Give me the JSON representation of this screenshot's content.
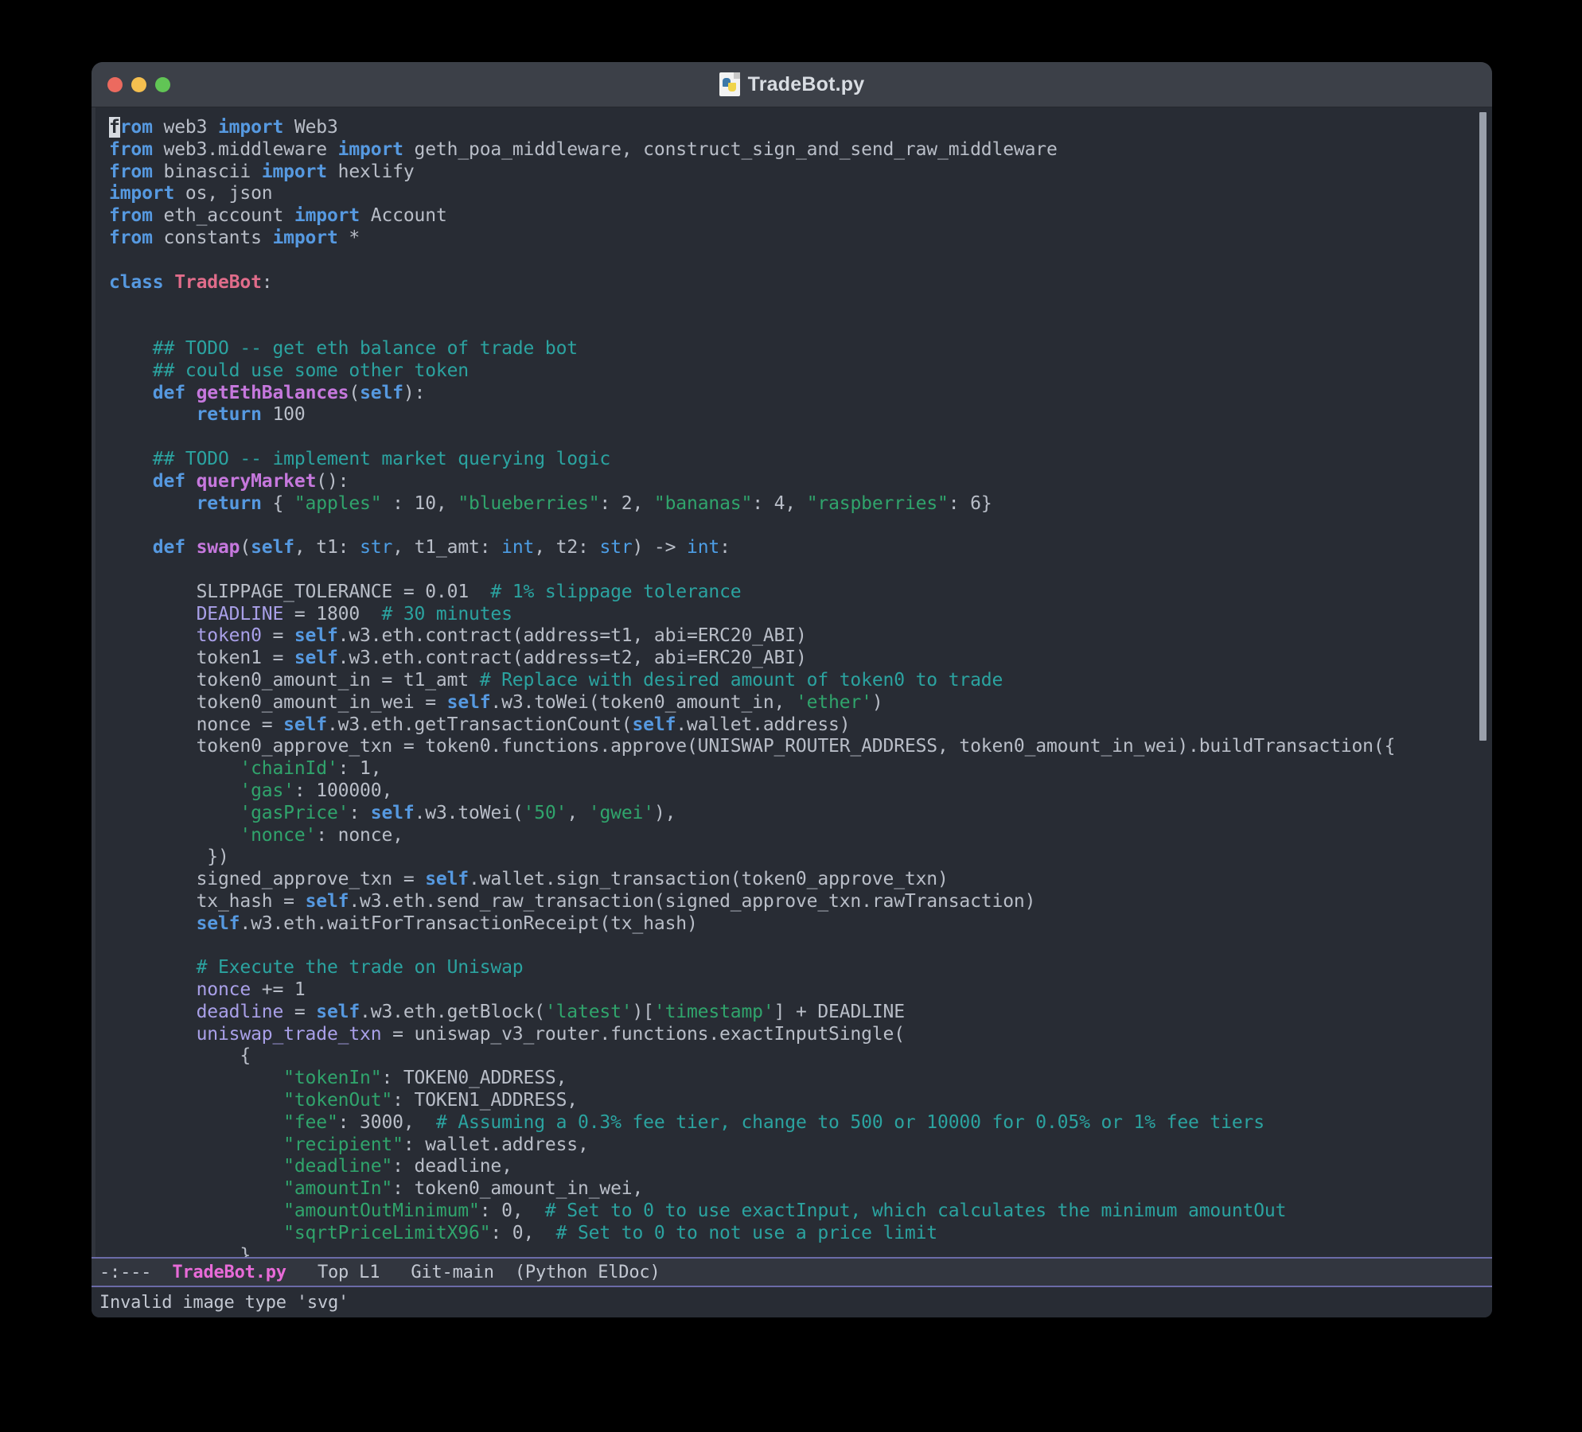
{
  "window": {
    "title": "TradeBot.py",
    "icon": "python-file-icon",
    "traffic_lights": [
      {
        "name": "close-button",
        "color": "#ec6a5f"
      },
      {
        "name": "minimize-button",
        "color": "#f5bf4f"
      },
      {
        "name": "maximize-button",
        "color": "#61c555"
      }
    ]
  },
  "theme": {
    "background": "#282c34",
    "titlebar": "#3c4048",
    "foreground": "#b9bec8",
    "keyword": "#5699e0",
    "class_name": "#e06c8a",
    "function_name": "#c678dd",
    "comment": "#2ba3a0",
    "string": "#30a46c",
    "variable": "#a9a0e8",
    "modeline_accent": "#6b6ba8",
    "modeline_filename": "#e86bd8"
  },
  "modeline": {
    "indicators": "-:---",
    "filename": "TradeBot.py",
    "position": "Top L1",
    "vc": "Git-main",
    "modes": "(Python ElDoc)"
  },
  "echo_area": {
    "message": "Invalid image type 'svg'"
  },
  "editor": {
    "cursor_line": 1,
    "cursor_column": 1,
    "language": "Python",
    "lines": [
      [
        {
          "t": "from",
          "c": "kw",
          "cursor_first": true
        },
        {
          "t": " web3 ",
          "c": "plain"
        },
        {
          "t": "import",
          "c": "kw"
        },
        {
          "t": " Web3",
          "c": "plain"
        }
      ],
      [
        {
          "t": "from",
          "c": "kw"
        },
        {
          "t": " web3.middleware ",
          "c": "plain"
        },
        {
          "t": "import",
          "c": "kw"
        },
        {
          "t": " geth_poa_middleware, construct_sign_and_send_raw_middleware",
          "c": "plain"
        }
      ],
      [
        {
          "t": "from",
          "c": "kw"
        },
        {
          "t": " binascii ",
          "c": "plain"
        },
        {
          "t": "import",
          "c": "kw"
        },
        {
          "t": " hexlify",
          "c": "plain"
        }
      ],
      [
        {
          "t": "import",
          "c": "kw"
        },
        {
          "t": " os, json",
          "c": "plain"
        }
      ],
      [
        {
          "t": "from",
          "c": "kw"
        },
        {
          "t": " eth_account ",
          "c": "plain"
        },
        {
          "t": "import",
          "c": "kw"
        },
        {
          "t": " Account",
          "c": "plain"
        }
      ],
      [
        {
          "t": "from",
          "c": "kw"
        },
        {
          "t": " constants ",
          "c": "plain"
        },
        {
          "t": "import",
          "c": "kw"
        },
        {
          "t": " *",
          "c": "plain"
        }
      ],
      [],
      [
        {
          "t": "class",
          "c": "kw"
        },
        {
          "t": " ",
          "c": "plain"
        },
        {
          "t": "TradeBot",
          "c": "cls"
        },
        {
          "t": ":",
          "c": "plain"
        }
      ],
      [],
      [],
      [
        {
          "t": "    ## TODO -- get eth balance of trade bot",
          "c": "cmt"
        }
      ],
      [
        {
          "t": "    ## could use some other token",
          "c": "cmt"
        }
      ],
      [
        {
          "t": "    ",
          "c": "plain"
        },
        {
          "t": "def",
          "c": "kw"
        },
        {
          "t": " ",
          "c": "plain"
        },
        {
          "t": "getEthBalances",
          "c": "fn"
        },
        {
          "t": "(",
          "c": "plain"
        },
        {
          "t": "self",
          "c": "self"
        },
        {
          "t": "):",
          "c": "plain"
        }
      ],
      [
        {
          "t": "        ",
          "c": "plain"
        },
        {
          "t": "return",
          "c": "kw"
        },
        {
          "t": " 100",
          "c": "plain"
        }
      ],
      [],
      [
        {
          "t": "    ## TODO -- implement market querying logic",
          "c": "cmt"
        }
      ],
      [
        {
          "t": "    ",
          "c": "plain"
        },
        {
          "t": "def",
          "c": "kw"
        },
        {
          "t": " ",
          "c": "plain"
        },
        {
          "t": "queryMarket",
          "c": "fn"
        },
        {
          "t": "():",
          "c": "plain"
        }
      ],
      [
        {
          "t": "        ",
          "c": "plain"
        },
        {
          "t": "return",
          "c": "kw"
        },
        {
          "t": " { ",
          "c": "plain"
        },
        {
          "t": "\"apples\"",
          "c": "str"
        },
        {
          "t": " : 10, ",
          "c": "plain"
        },
        {
          "t": "\"blueberries\"",
          "c": "str"
        },
        {
          "t": ": 2, ",
          "c": "plain"
        },
        {
          "t": "\"bananas\"",
          "c": "str"
        },
        {
          "t": ": 4, ",
          "c": "plain"
        },
        {
          "t": "\"raspberries\"",
          "c": "str"
        },
        {
          "t": ": 6}",
          "c": "plain"
        }
      ],
      [],
      [
        {
          "t": "    ",
          "c": "plain"
        },
        {
          "t": "def",
          "c": "kw"
        },
        {
          "t": " ",
          "c": "plain"
        },
        {
          "t": "swap",
          "c": "fn"
        },
        {
          "t": "(",
          "c": "plain"
        },
        {
          "t": "self",
          "c": "self"
        },
        {
          "t": ", t1: ",
          "c": "plain"
        },
        {
          "t": "str",
          "c": "type"
        },
        {
          "t": ", t1_amt: ",
          "c": "plain"
        },
        {
          "t": "int",
          "c": "type"
        },
        {
          "t": ", t2: ",
          "c": "plain"
        },
        {
          "t": "str",
          "c": "type"
        },
        {
          "t": ") -> ",
          "c": "plain"
        },
        {
          "t": "int",
          "c": "type"
        },
        {
          "t": ":",
          "c": "plain"
        }
      ],
      [],
      [
        {
          "t": "        SLIPPAGE_TOLERANCE",
          "c": "plain"
        },
        {
          "t": " = 0.01  ",
          "c": "plain"
        },
        {
          "t": "# 1% slippage tolerance",
          "c": "cmt"
        }
      ],
      [
        {
          "t": "        ",
          "c": "plain"
        },
        {
          "t": "DEADLINE",
          "c": "var"
        },
        {
          "t": " = 1800  ",
          "c": "plain"
        },
        {
          "t": "# 30 minutes",
          "c": "cmt"
        }
      ],
      [
        {
          "t": "        ",
          "c": "plain"
        },
        {
          "t": "token0",
          "c": "var"
        },
        {
          "t": " = ",
          "c": "plain"
        },
        {
          "t": "self",
          "c": "self"
        },
        {
          "t": ".w3.eth.contract(address=t1, abi=ERC20_ABI)",
          "c": "plain"
        }
      ],
      [
        {
          "t": "        token1 = ",
          "c": "plain"
        },
        {
          "t": "self",
          "c": "self"
        },
        {
          "t": ".w3.eth.contract(address=t2, abi=ERC20_ABI)",
          "c": "plain"
        }
      ],
      [
        {
          "t": "        token0_amount_in = t1_amt ",
          "c": "plain"
        },
        {
          "t": "# Replace with desired amount of token0 to trade",
          "c": "cmt"
        }
      ],
      [
        {
          "t": "        token0_amount_in_wei = ",
          "c": "plain"
        },
        {
          "t": "self",
          "c": "self"
        },
        {
          "t": ".w3.toWei(token0_amount_in, ",
          "c": "plain"
        },
        {
          "t": "'ether'",
          "c": "str"
        },
        {
          "t": ")",
          "c": "plain"
        }
      ],
      [
        {
          "t": "        nonce = ",
          "c": "plain"
        },
        {
          "t": "self",
          "c": "self"
        },
        {
          "t": ".w3.eth.getTransactionCount(",
          "c": "plain"
        },
        {
          "t": "self",
          "c": "self"
        },
        {
          "t": ".wallet.address)",
          "c": "plain"
        }
      ],
      [
        {
          "t": "        token0_approve_txn = token0.functions.approve(UNISWAP_ROUTER_ADDRESS, token0_amount_in_wei).buildTransaction({",
          "c": "plain"
        }
      ],
      [
        {
          "t": "            ",
          "c": "plain"
        },
        {
          "t": "'chainId'",
          "c": "str"
        },
        {
          "t": ": 1,",
          "c": "plain"
        }
      ],
      [
        {
          "t": "            ",
          "c": "plain"
        },
        {
          "t": "'gas'",
          "c": "str"
        },
        {
          "t": ": 100000,",
          "c": "plain"
        }
      ],
      [
        {
          "t": "            ",
          "c": "plain"
        },
        {
          "t": "'gasPrice'",
          "c": "str"
        },
        {
          "t": ": ",
          "c": "plain"
        },
        {
          "t": "self",
          "c": "self"
        },
        {
          "t": ".w3.toWei(",
          "c": "plain"
        },
        {
          "t": "'50'",
          "c": "str"
        },
        {
          "t": ", ",
          "c": "plain"
        },
        {
          "t": "'gwei'",
          "c": "str"
        },
        {
          "t": "),",
          "c": "plain"
        }
      ],
      [
        {
          "t": "            ",
          "c": "plain"
        },
        {
          "t": "'nonce'",
          "c": "str"
        },
        {
          "t": ": nonce,",
          "c": "plain"
        }
      ],
      [
        {
          "t": "         })",
          "c": "plain"
        }
      ],
      [
        {
          "t": "        signed_approve_txn = ",
          "c": "plain"
        },
        {
          "t": "self",
          "c": "self"
        },
        {
          "t": ".wallet.sign_transaction(token0_approve_txn)",
          "c": "plain"
        }
      ],
      [
        {
          "t": "        tx_hash = ",
          "c": "plain"
        },
        {
          "t": "self",
          "c": "self"
        },
        {
          "t": ".w3.eth.send_raw_transaction(signed_approve_txn.rawTransaction)",
          "c": "plain"
        }
      ],
      [
        {
          "t": "        ",
          "c": "plain"
        },
        {
          "t": "self",
          "c": "self"
        },
        {
          "t": ".w3.eth.waitForTransactionReceipt(tx_hash)",
          "c": "plain"
        }
      ],
      [],
      [
        {
          "t": "        ",
          "c": "plain"
        },
        {
          "t": "# Execute the trade on Uniswap",
          "c": "cmt"
        }
      ],
      [
        {
          "t": "        ",
          "c": "plain"
        },
        {
          "t": "nonce",
          "c": "var"
        },
        {
          "t": " += 1",
          "c": "plain"
        }
      ],
      [
        {
          "t": "        ",
          "c": "plain"
        },
        {
          "t": "deadline",
          "c": "var"
        },
        {
          "t": " = ",
          "c": "plain"
        },
        {
          "t": "self",
          "c": "self"
        },
        {
          "t": ".w3.eth.getBlock(",
          "c": "plain"
        },
        {
          "t": "'latest'",
          "c": "str"
        },
        {
          "t": ")[",
          "c": "plain"
        },
        {
          "t": "'timestamp'",
          "c": "str"
        },
        {
          "t": "] + DEADLINE",
          "c": "plain"
        }
      ],
      [
        {
          "t": "        ",
          "c": "plain"
        },
        {
          "t": "uniswap_trade_txn",
          "c": "var"
        },
        {
          "t": " = uniswap_v3_router.functions.exactInputSingle(",
          "c": "plain"
        }
      ],
      [
        {
          "t": "            {",
          "c": "plain"
        }
      ],
      [
        {
          "t": "                ",
          "c": "plain"
        },
        {
          "t": "\"tokenIn\"",
          "c": "str"
        },
        {
          "t": ": TOKEN0_ADDRESS,",
          "c": "plain"
        }
      ],
      [
        {
          "t": "                ",
          "c": "plain"
        },
        {
          "t": "\"tokenOut\"",
          "c": "str"
        },
        {
          "t": ": TOKEN1_ADDRESS,",
          "c": "plain"
        }
      ],
      [
        {
          "t": "                ",
          "c": "plain"
        },
        {
          "t": "\"fee\"",
          "c": "str"
        },
        {
          "t": ": 3000,  ",
          "c": "plain"
        },
        {
          "t": "# Assuming a 0.3% fee tier, change to 500 or 10000 for 0.05% or 1% fee tiers",
          "c": "cmt"
        }
      ],
      [
        {
          "t": "                ",
          "c": "plain"
        },
        {
          "t": "\"recipient\"",
          "c": "str"
        },
        {
          "t": ": wallet.address,",
          "c": "plain"
        }
      ],
      [
        {
          "t": "                ",
          "c": "plain"
        },
        {
          "t": "\"deadline\"",
          "c": "str"
        },
        {
          "t": ": deadline,",
          "c": "plain"
        }
      ],
      [
        {
          "t": "                ",
          "c": "plain"
        },
        {
          "t": "\"amountIn\"",
          "c": "str"
        },
        {
          "t": ": token0_amount_in_wei,",
          "c": "plain"
        }
      ],
      [
        {
          "t": "                ",
          "c": "plain"
        },
        {
          "t": "\"amountOutMinimum\"",
          "c": "str"
        },
        {
          "t": ": 0,  ",
          "c": "plain"
        },
        {
          "t": "# Set to 0 to use exactInput, which calculates the minimum amountOut",
          "c": "cmt"
        }
      ],
      [
        {
          "t": "                ",
          "c": "plain"
        },
        {
          "t": "\"sqrtPriceLimitX96\"",
          "c": "str"
        },
        {
          "t": ": 0,  ",
          "c": "plain"
        },
        {
          "t": "# Set to 0 to not use a price limit",
          "c": "cmt"
        }
      ],
      [
        {
          "t": "            }",
          "c": "plain"
        }
      ]
    ]
  }
}
